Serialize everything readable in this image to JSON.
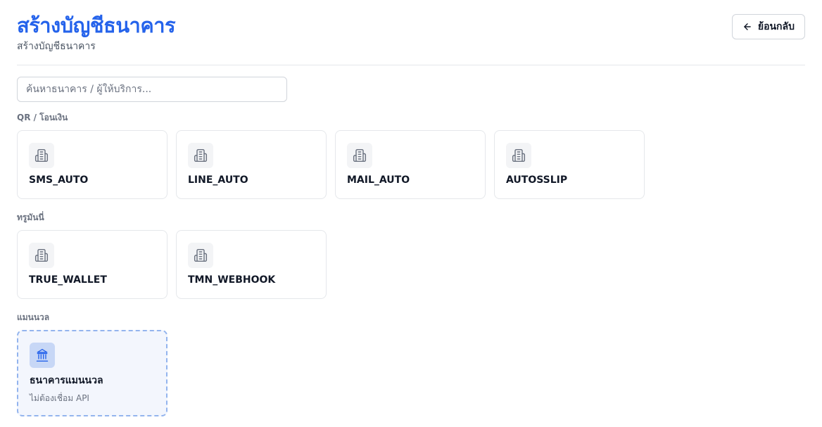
{
  "header": {
    "title": "สร้างบัญชีธนาคาร",
    "subtitle": "สร้างบัญชีธนาคาร",
    "back_label": "ย้อนกลับ",
    "back_icon": "arrow-left-icon"
  },
  "search": {
    "value": "",
    "placeholder": "ค้นหาธนาคาร / ผู้ให้บริการ..."
  },
  "sections": [
    {
      "label": "QR / โอนเงิน",
      "items": [
        {
          "label": "SMS_AUTO",
          "icon": "building-icon"
        },
        {
          "label": "LINE_AUTO",
          "icon": "building-icon"
        },
        {
          "label": "MAIL_AUTO",
          "icon": "building-icon"
        },
        {
          "label": "AUTOSSLIP",
          "icon": "building-icon"
        }
      ]
    },
    {
      "label": "ทรูมันนี่",
      "items": [
        {
          "label": "TRUE_WALLET",
          "icon": "building-icon"
        },
        {
          "label": "TMN_WEBHOOK",
          "icon": "building-icon"
        }
      ]
    },
    {
      "label": "แมนนวล",
      "items": [
        {
          "label": "ธนาคารแมนนวล",
          "sub": "ไม่ต้องเชื่อม API",
          "icon": "bank-icon"
        }
      ]
    }
  ],
  "colors": {
    "accent": "#2563eb",
    "manual_border": "#93b4ee",
    "manual_bg": "#f3f6fd"
  }
}
